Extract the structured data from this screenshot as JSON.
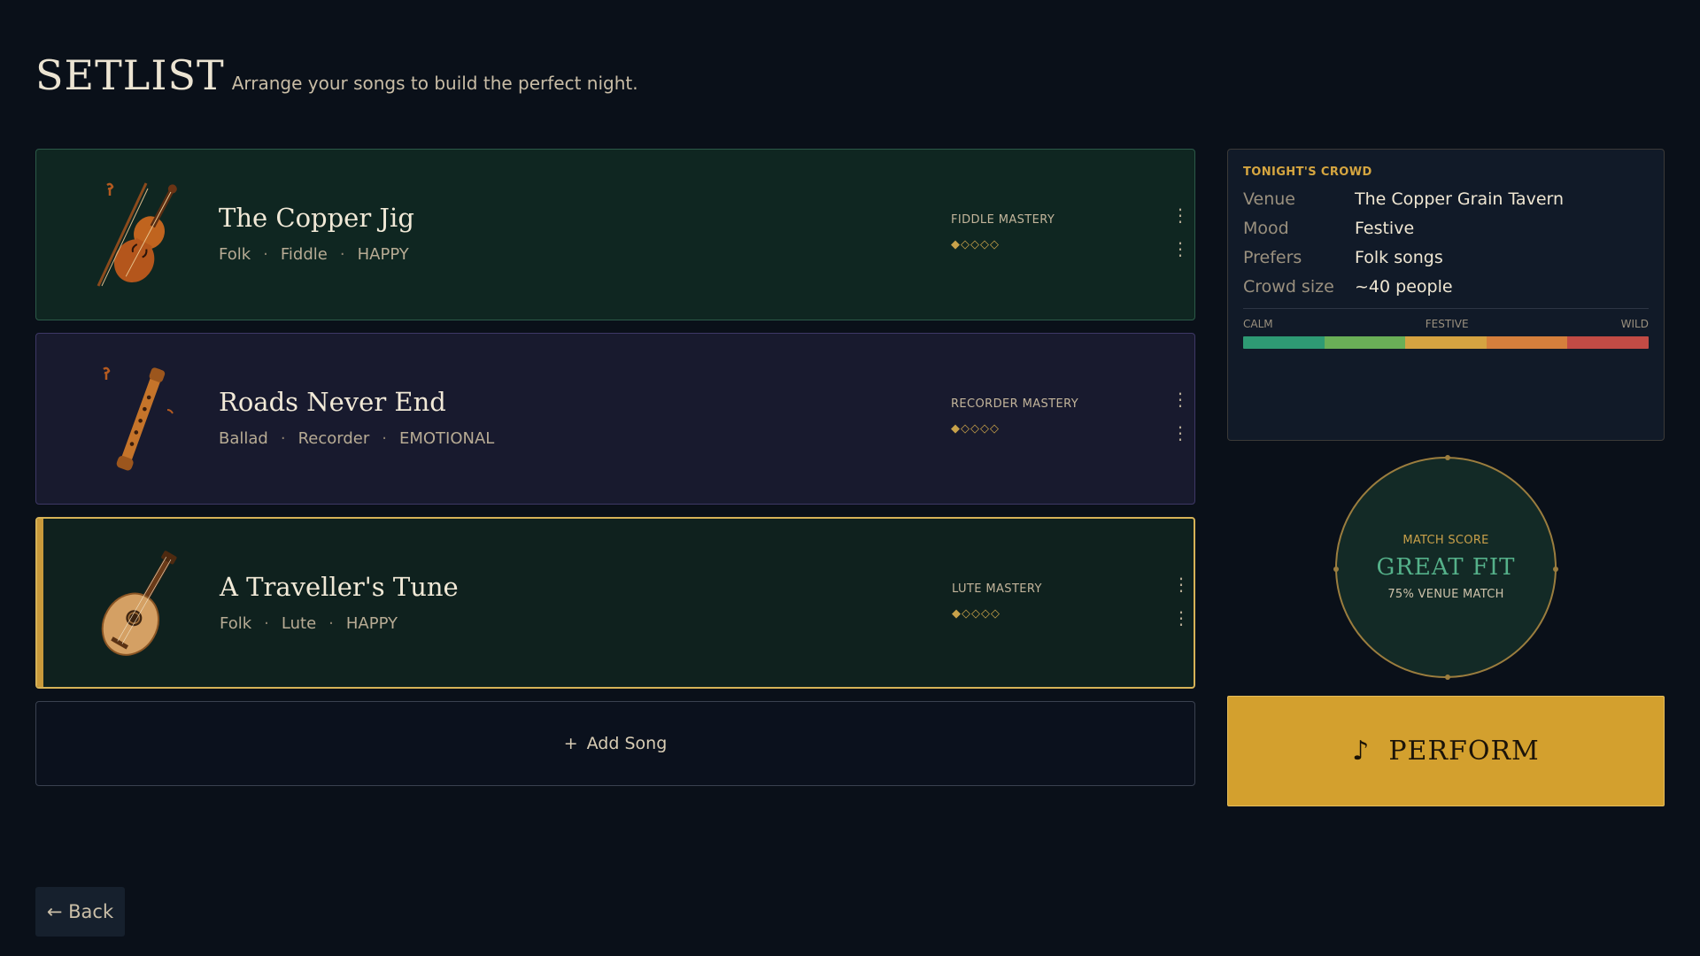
{
  "header": {
    "title": "SETLIST",
    "subtitle": "Arrange your songs to build the perfect night."
  },
  "songs": [
    {
      "title": "The Copper Jig",
      "genre": "Folk",
      "instrument": "Fiddle",
      "mood": "HAPPY",
      "mastery_label": "FIDDLE MASTERY",
      "mastery_stars": "◆◇◇◇◇",
      "mastery_level": 1,
      "mastery_max": 5,
      "icon": "fiddle-icon"
    },
    {
      "title": "Roads Never End",
      "genre": "Ballad",
      "instrument": "Recorder",
      "mood": "EMOTIONAL",
      "mastery_label": "RECORDER MASTERY",
      "mastery_stars": "◆◇◇◇◇",
      "mastery_level": 1,
      "mastery_max": 5,
      "icon": "recorder-icon"
    },
    {
      "title": "A Traveller's Tune",
      "genre": "Folk",
      "instrument": "Lute",
      "mood": "HAPPY",
      "mastery_label": "LUTE MASTERY",
      "mastery_stars": "◆◇◇◇◇",
      "mastery_level": 1,
      "mastery_max": 5,
      "icon": "lute-icon"
    }
  ],
  "separator": "·",
  "handle_glyph": "⋮",
  "add_song": {
    "plus": "+",
    "label": "Add Song"
  },
  "crowd": {
    "heading": "TONIGHT'S CROWD",
    "rows": [
      {
        "key": "Venue",
        "value": "The Copper Grain Tavern"
      },
      {
        "key": "Mood",
        "value": "Festive"
      },
      {
        "key": "Prefers",
        "value": "Folk songs"
      },
      {
        "key": "Crowd size",
        "value": "~40 people"
      }
    ],
    "mood_scale": {
      "low": "CALM",
      "mid": "FESTIVE",
      "high": "WILD"
    },
    "mood_colors": [
      "#2e9a74",
      "#6aaf57",
      "#d5a341",
      "#d57f3c",
      "#c24b45"
    ]
  },
  "match": {
    "label": "MATCH SCORE",
    "value": "GREAT FIT",
    "sub": "75% VENUE MATCH"
  },
  "perform": {
    "icon": "♪",
    "label": "PERFORM"
  },
  "back": {
    "label": "← Back"
  },
  "colors": {
    "accent_gold": "#d3a02e",
    "match_green": "#55b18a",
    "background": "#0a1019"
  }
}
